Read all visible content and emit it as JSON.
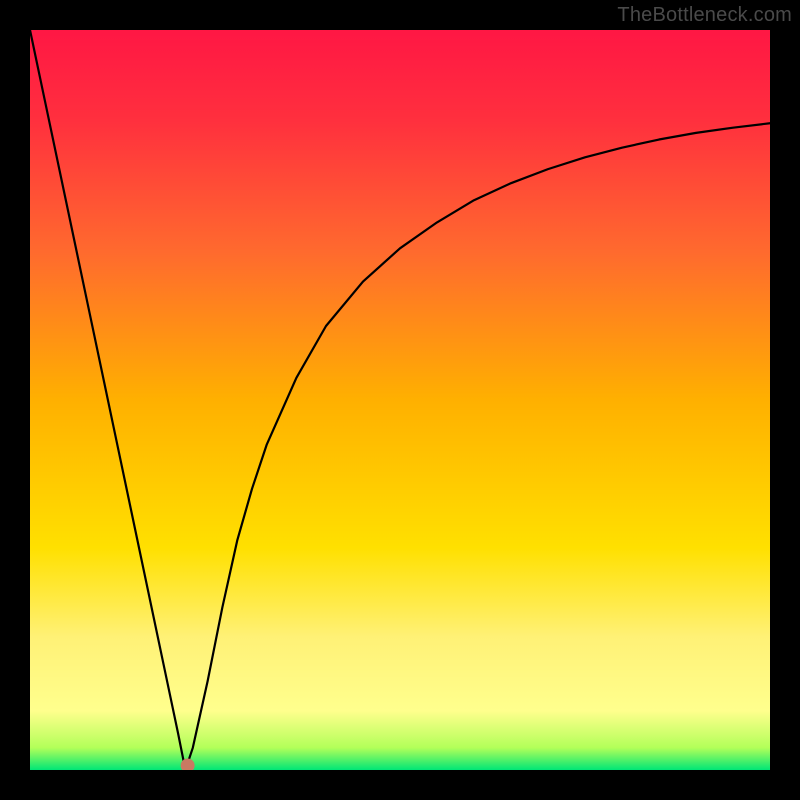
{
  "watermark": {
    "text": "TheBottleneck.com"
  },
  "chart_data": {
    "type": "line",
    "title": "",
    "xlabel": "",
    "ylabel": "",
    "xlim": [
      0,
      100
    ],
    "ylim": [
      0,
      100
    ],
    "grid": false,
    "legend": null,
    "background_gradient": {
      "stops": [
        {
          "offset": 0.0,
          "color": "#ff1744"
        },
        {
          "offset": 0.12,
          "color": "#ff2f3e"
        },
        {
          "offset": 0.3,
          "color": "#ff6a2e"
        },
        {
          "offset": 0.5,
          "color": "#ffb000"
        },
        {
          "offset": 0.7,
          "color": "#ffe000"
        },
        {
          "offset": 0.82,
          "color": "#fff176"
        },
        {
          "offset": 0.92,
          "color": "#ffff8d"
        },
        {
          "offset": 0.97,
          "color": "#b2ff59"
        },
        {
          "offset": 1.0,
          "color": "#00e676"
        }
      ]
    },
    "series": [
      {
        "name": "bottleneck-curve",
        "color": "#000000",
        "width": 2.2,
        "x": [
          0,
          2,
          4,
          6,
          8,
          10,
          12,
          14,
          16,
          18,
          20,
          21,
          22,
          24,
          26,
          28,
          30,
          32,
          36,
          40,
          45,
          50,
          55,
          60,
          65,
          70,
          75,
          80,
          85,
          90,
          95,
          100
        ],
        "y": [
          100,
          90.5,
          81,
          71.5,
          62,
          52.5,
          43,
          33.5,
          24,
          14.5,
          5,
          0,
          3,
          12,
          22,
          31,
          38,
          44,
          53,
          60,
          66,
          70.5,
          74,
          77,
          79.3,
          81.2,
          82.8,
          84.1,
          85.2,
          86.1,
          86.8,
          87.4
        ]
      }
    ],
    "markers": [
      {
        "name": "min-point",
        "x": 21.3,
        "y": 0.6,
        "r": 7,
        "color": "#c97a62"
      }
    ]
  }
}
